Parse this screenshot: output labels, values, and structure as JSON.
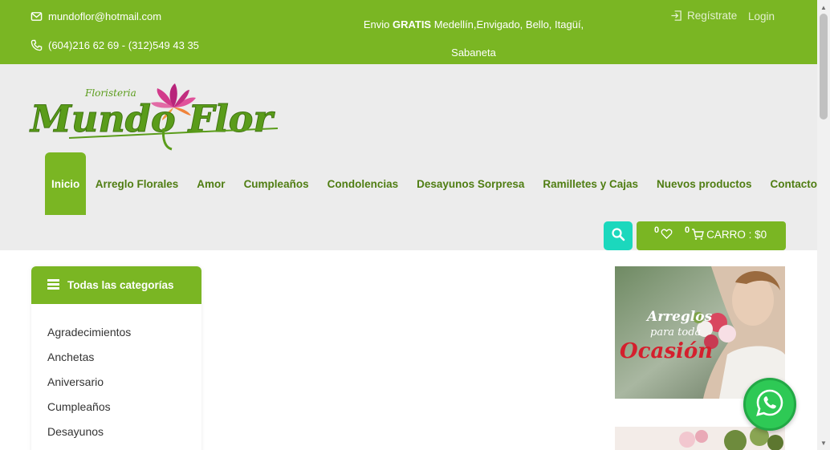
{
  "topbar": {
    "email": "mundoflor@hotmail.com",
    "phone": "(604)216 62 69 - (312)549 43 35",
    "shipping_prefix": "Envio ",
    "shipping_bold": "GRATIS",
    "shipping_line1": " Medellín,Envigado, Bello, Itagüí,",
    "shipping_line2": "Sabaneta",
    "register_label": "Regístrate",
    "login_label": "Login"
  },
  "logo": {
    "small_text": "Floristeria",
    "brand_text": "Mundo Flor"
  },
  "nav": {
    "items": [
      {
        "label": "Inicio"
      },
      {
        "label": "Arreglo Florales"
      },
      {
        "label": "Amor"
      },
      {
        "label": "Cumpleaños"
      },
      {
        "label": "Condolencias"
      },
      {
        "label": "Desayunos Sorpresa"
      },
      {
        "label": "Ramilletes y Cajas"
      },
      {
        "label": "Nuevos productos"
      },
      {
        "label": "Contacto"
      }
    ]
  },
  "cart": {
    "wishlist_count": "0",
    "cart_count": "0",
    "label": "CARRO : $0"
  },
  "categories": {
    "title": "Todas las categorías",
    "items": [
      "Agradecimientos",
      "Anchetas",
      "Aniversario",
      "Cumpleaños",
      "Desayunos"
    ]
  },
  "banners": {
    "banner1_line1": "Arreglos",
    "banner1_line2": "para toda",
    "banner1_line3": "Ocasión"
  },
  "colors": {
    "brand_green": "#7ab623",
    "nav_text": "#4f7d12",
    "search_teal": "#1bd8bd",
    "whatsapp_green": "#2ec955"
  },
  "icons": [
    "mail-icon",
    "phone-icon",
    "login-icon",
    "search-icon",
    "heart-icon",
    "cart-icon",
    "list-icon",
    "whatsapp-icon"
  ]
}
